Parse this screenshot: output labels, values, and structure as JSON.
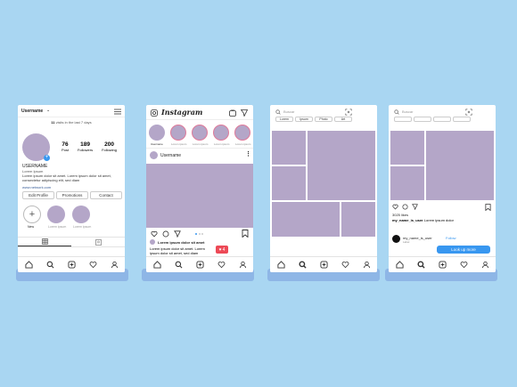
{
  "profile": {
    "username_header": "Username",
    "visits_count": "11",
    "visits_text": "visits in the last 7 days",
    "stats": [
      {
        "value": "76",
        "label": "Post"
      },
      {
        "value": "189",
        "label": "Followers"
      },
      {
        "value": "200",
        "label": "Following"
      }
    ],
    "name": "USERNAME",
    "subtitle": "Lorem Ipsum",
    "bio": "Lorem ipsum dolor sit amet. Lorem ipsum dolor sit amet, consectetur adipiscing elit, sed diam",
    "link": "www.network.com",
    "buttons": {
      "edit": "Edit Profile",
      "promotions": "Promotions",
      "contact": "Contact"
    },
    "highlights": [
      {
        "label": "New"
      },
      {
        "label": "Lorem ipsum"
      },
      {
        "label": "Lorem ipsum"
      }
    ]
  },
  "feed": {
    "logo": "Instagram",
    "stories": [
      "Username",
      "Lorem ipsum",
      "Lorem ipsum",
      "Lorem ipsum",
      "Lorem ipsum"
    ],
    "post_user": "Username",
    "caption_line1": "Lorem ipsum dolor sit amet",
    "caption_line2": "Lorem ipsum dolor sit amet. Lorem ipsum dolor sit amet, sed diam",
    "like_count": "4"
  },
  "explore": {
    "search_placeholder": "Buscar",
    "filters": [
      "Lorem",
      "Ipsum",
      "Photo",
      "Art"
    ]
  },
  "detail": {
    "search_placeholder": "Buscar",
    "likes": "3025 likes",
    "caption_user": "my_name_is_user",
    "caption_text": "Lorem ipsum dolor",
    "account_name": "my_name_is_user",
    "account_sub": "Label",
    "follow": "Follow",
    "look_more": "Look up more"
  },
  "colors": {
    "background": "#a9d6f2",
    "placeholder": "#b4a6c8",
    "accent": "#3897f0",
    "notify": "#ed4956"
  }
}
